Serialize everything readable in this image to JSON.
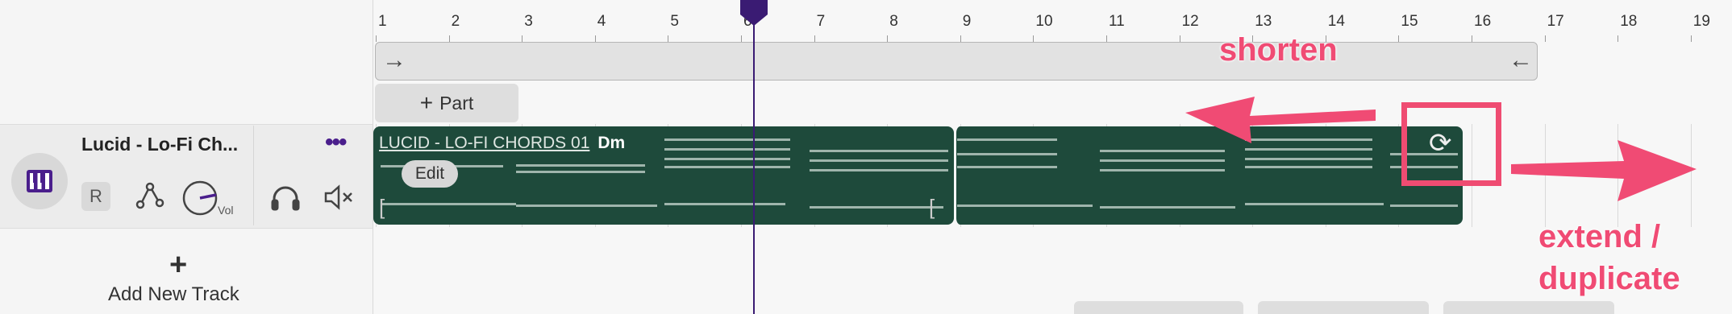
{
  "track": {
    "name": "Lucid - Lo-Fi Ch...",
    "more_label": "•••",
    "record_label": "R",
    "volume_label": "Vol",
    "instrument_icon": "piano-icon",
    "automation_icon": "automation-icon",
    "headphones_icon": "headphones-icon",
    "mute_icon": "mute-icon"
  },
  "add_track": {
    "plus": "+",
    "label": "Add New Track"
  },
  "ruler": {
    "bars": [
      "1",
      "2",
      "3",
      "4",
      "5",
      "6",
      "7",
      "8",
      "9",
      "10",
      "11",
      "12",
      "13",
      "14",
      "15",
      "16",
      "17",
      "18",
      "19"
    ]
  },
  "loop": {
    "start_arrow": "→",
    "end_arrow": "←"
  },
  "part_button": {
    "label": "Part",
    "icon": "plus-icon"
  },
  "region": {
    "name": "LUCID - LO-FI CHORDS 01",
    "key": "Dm",
    "edit_label": "Edit",
    "start_marker": "[",
    "end_marker": "["
  },
  "annotations": {
    "shorten": "shorten",
    "extend_line1": "extend /",
    "extend_line2": "duplicate",
    "accent": "#f04b74"
  },
  "colors": {
    "region": "#1e4a3b",
    "playhead": "#3a1b73"
  }
}
